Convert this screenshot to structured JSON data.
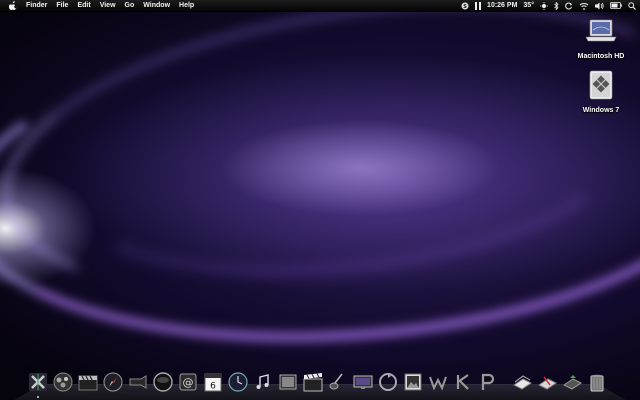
{
  "menubar": {
    "app_name": "Finder",
    "menus": [
      "File",
      "Edit",
      "View",
      "Go",
      "Window",
      "Help"
    ],
    "clock": "10:26 PM",
    "temperature": "35°"
  },
  "desktop": {
    "icons": [
      {
        "label": "Macintosh HD"
      },
      {
        "label": "Windows 7"
      }
    ]
  },
  "dock": {
    "calendar_day": "6",
    "items": [
      "finder-icon",
      "dashboard-icon",
      "clapperboard-icon",
      "safari-icon",
      "mail-stamp-icon",
      "photo-booth-icon",
      "address-book-icon",
      "ical-icon",
      "time-machine-icon",
      "itunes-icon",
      "preview-icon",
      "imovie-icon",
      "guitar-icon",
      "monitor-icon",
      "recycle-icon",
      "iphoto-icon",
      "app-w-icon",
      "app-k-icon",
      "app-p-icon",
      "documents-stack-icon",
      "applications-stack-icon",
      "downloads-stack-icon",
      "trash-icon"
    ]
  },
  "colors": {
    "menubar_bg": "#0a0a0a",
    "wallpaper_primary": "#2c1c56",
    "wallpaper_accent": "#9b6fe0"
  }
}
